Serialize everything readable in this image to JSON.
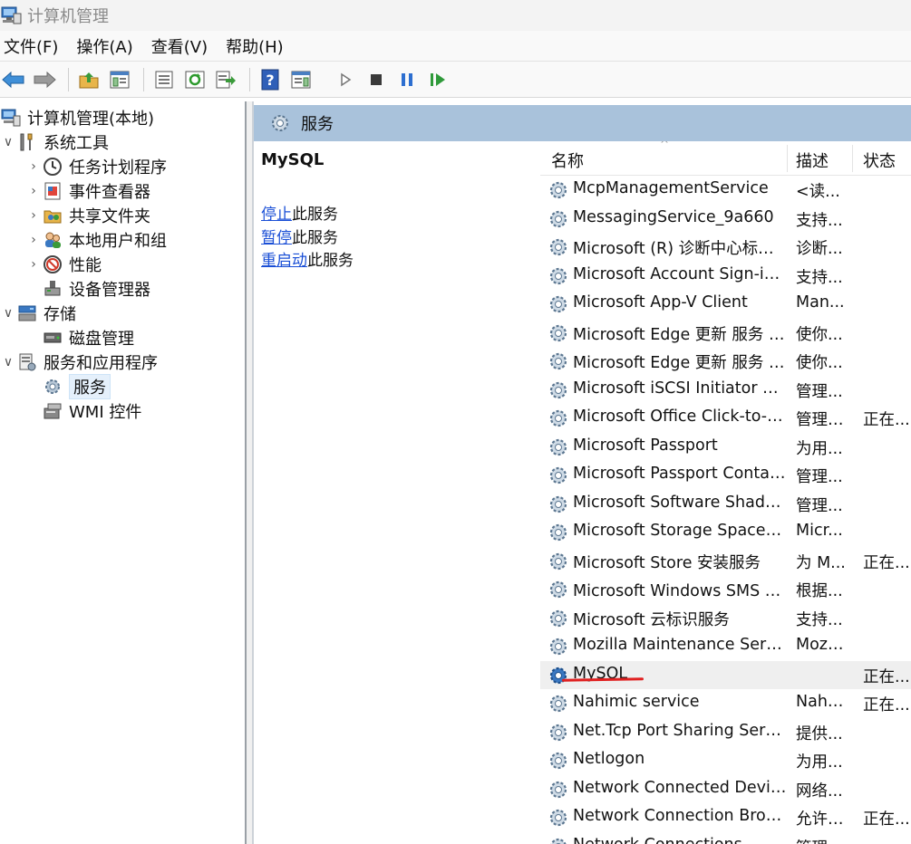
{
  "window": {
    "title": "计算机管理"
  },
  "menu": [
    "文件(F)",
    "操作(A)",
    "查看(V)",
    "帮助(H)"
  ],
  "tree": {
    "root": "计算机管理(本地)",
    "items": [
      {
        "label": "系统工具",
        "level": 1,
        "expander": "∨",
        "icon": "tools-icon"
      },
      {
        "label": "任务计划程序",
        "level": 2,
        "expander": "›",
        "icon": "clock-icon"
      },
      {
        "label": "事件查看器",
        "level": 2,
        "expander": "›",
        "icon": "event-viewer-icon"
      },
      {
        "label": "共享文件夹",
        "level": 2,
        "expander": "›",
        "icon": "shared-folder-icon"
      },
      {
        "label": "本地用户和组",
        "level": 2,
        "expander": "›",
        "icon": "users-icon"
      },
      {
        "label": "性能",
        "level": 2,
        "expander": "›",
        "icon": "performance-icon"
      },
      {
        "label": "设备管理器",
        "level": 2,
        "expander": "",
        "icon": "device-manager-icon"
      },
      {
        "label": "存储",
        "level": 1,
        "expander": "∨",
        "icon": "storage-icon"
      },
      {
        "label": "磁盘管理",
        "level": 2,
        "expander": "",
        "icon": "disk-icon"
      },
      {
        "label": "服务和应用程序",
        "level": 1,
        "expander": "∨",
        "icon": "services-apps-icon"
      },
      {
        "label": "服务",
        "level": 2,
        "expander": "",
        "icon": "services-icon",
        "selected": true
      },
      {
        "label": "WMI 控件",
        "level": 2,
        "expander": "",
        "icon": "wmi-icon"
      }
    ]
  },
  "panel": {
    "header": "服务",
    "selected_service": "MySQL",
    "actions": [
      {
        "link": "停止",
        "rest": "此服务"
      },
      {
        "link": "暂停",
        "rest": "此服务"
      },
      {
        "link": "重启动",
        "rest": "此服务"
      }
    ]
  },
  "list": {
    "columns": {
      "name": "名称",
      "desc": "描述",
      "status": "状态"
    },
    "rows": [
      {
        "name": "McpManagementService",
        "desc": "<读...",
        "status": ""
      },
      {
        "name": "MessagingService_9a660",
        "desc": "支持...",
        "status": ""
      },
      {
        "name": "Microsoft (R) 诊断中心标准...",
        "desc": "诊断...",
        "status": ""
      },
      {
        "name": "Microsoft Account Sign-in ...",
        "desc": "支持...",
        "status": ""
      },
      {
        "name": "Microsoft App-V Client",
        "desc": "Man...",
        "status": ""
      },
      {
        "name": "Microsoft Edge 更新 服务 (...",
        "desc": "使你...",
        "status": ""
      },
      {
        "name": "Microsoft Edge 更新 服务 (...",
        "desc": "使你...",
        "status": ""
      },
      {
        "name": "Microsoft iSCSI Initiator Ser...",
        "desc": "管理...",
        "status": ""
      },
      {
        "name": "Microsoft Office Click-to-R...",
        "desc": "管理 ...",
        "status": "正在..."
      },
      {
        "name": "Microsoft Passport",
        "desc": "为用...",
        "status": ""
      },
      {
        "name": "Microsoft Passport Container",
        "desc": "管理...",
        "status": ""
      },
      {
        "name": "Microsoft Software Shado...",
        "desc": "管理...",
        "status": ""
      },
      {
        "name": "Microsoft Storage Spaces S...",
        "desc": "Micr...",
        "status": ""
      },
      {
        "name": "Microsoft Store 安装服务",
        "desc": "为 M...",
        "status": "正在..."
      },
      {
        "name": "Microsoft Windows SMS 路...",
        "desc": "根据...",
        "status": ""
      },
      {
        "name": "Microsoft 云标识服务",
        "desc": "支持...",
        "status": ""
      },
      {
        "name": "Mozilla Maintenance Service",
        "desc": "Mozi...",
        "status": ""
      },
      {
        "name": "MySQL",
        "desc": "",
        "status": "正在...",
        "highlight": true
      },
      {
        "name": "Nahimic service",
        "desc": "Nahi...",
        "status": "正在..."
      },
      {
        "name": "Net.Tcp Port Sharing Service",
        "desc": "提供...",
        "status": ""
      },
      {
        "name": "Netlogon",
        "desc": "为用...",
        "status": ""
      },
      {
        "name": "Network Connected Devic...",
        "desc": "网络...",
        "status": ""
      },
      {
        "name": "Network Connection Broker",
        "desc": "允许 ...",
        "status": "正在..."
      },
      {
        "name": "Network Connections",
        "desc": "管理\"...",
        "status": ""
      }
    ]
  },
  "colors": {
    "header_bg": "#a9c2db",
    "link": "#1a4fd6",
    "annotation": "#e02020",
    "selected_bg": "#e5f0fb"
  }
}
